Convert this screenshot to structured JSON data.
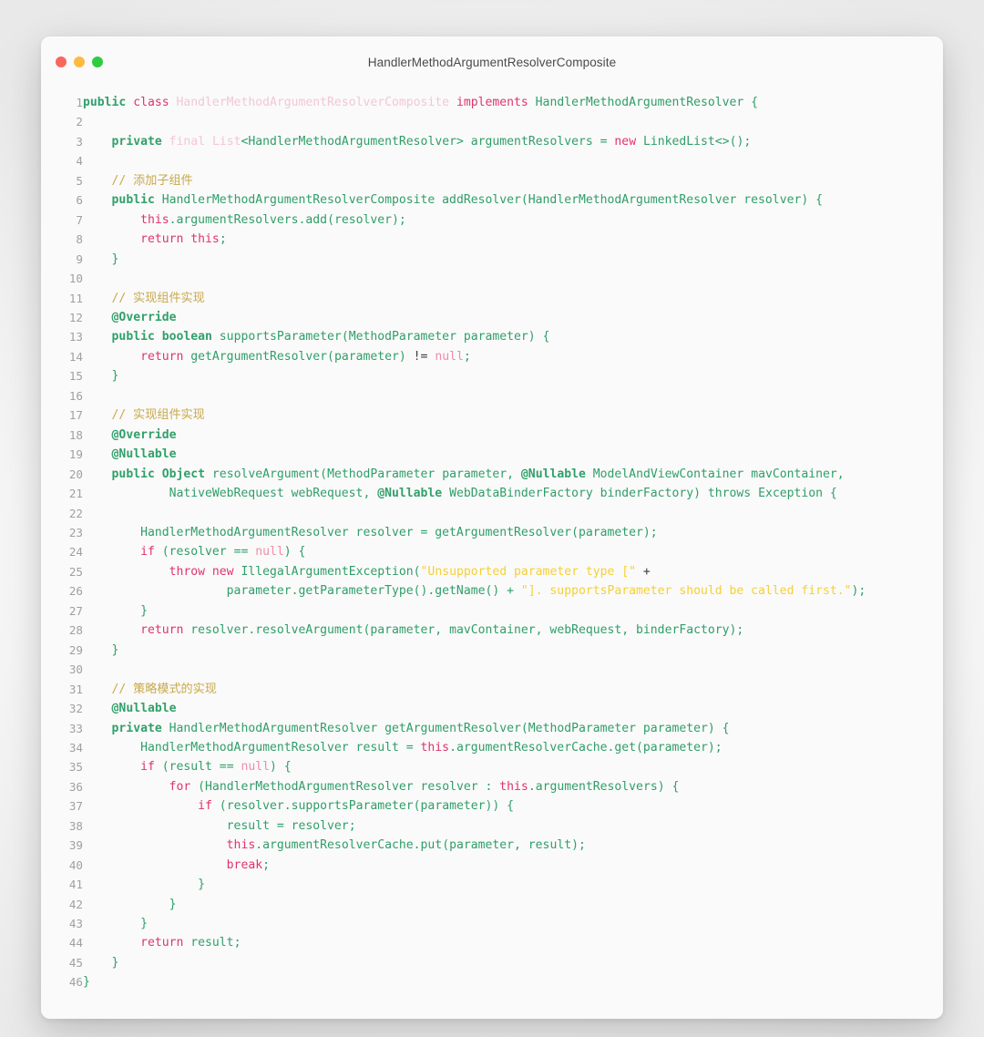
{
  "window": {
    "title": "HandlerMethodArgumentResolverComposite",
    "traffic_lights": [
      {
        "name": "close",
        "color": "#f9665e"
      },
      {
        "name": "minimize",
        "color": "#fcbb40"
      },
      {
        "name": "maximize",
        "color": "#2ecc40"
      }
    ]
  },
  "theme": {
    "background": "#fafafa",
    "page_background": "#ffffff",
    "line_number_color": "#a0a0a0",
    "keyword_color": "#e0346b",
    "declaration_color": "#31a06a",
    "type_color": "#2f9e68",
    "comment_color": "#c8a94b",
    "string_color": "#f5d033",
    "faded_color": "#f3c7d5"
  },
  "editor": {
    "language": "java",
    "first_line": 1,
    "last_line": 46,
    "line_numbers": [
      "1",
      "2",
      "3",
      "4",
      "5",
      "6",
      "7",
      "8",
      "9",
      "10",
      "11",
      "12",
      "13",
      "14",
      "15",
      "16",
      "17",
      "18",
      "19",
      "20",
      "21",
      "22",
      "23",
      "24",
      "25",
      "26",
      "27",
      "28",
      "29",
      "30",
      "31",
      "32",
      "33",
      "34",
      "35",
      "36",
      "37",
      "38",
      "39",
      "40",
      "41",
      "42",
      "43",
      "44",
      "45",
      "46"
    ],
    "lines": [
      "public class HandlerMethodArgumentResolverComposite implements HandlerMethodArgumentResolver {",
      "",
      "    private final List<HandlerMethodArgumentResolver> argumentResolvers = new LinkedList<>();",
      "",
      "    // 添加子组件",
      "    public HandlerMethodArgumentResolverComposite addResolver(HandlerMethodArgumentResolver resolver) {",
      "        this.argumentResolvers.add(resolver);",
      "        return this;",
      "    }",
      "",
      "    // 实现组件实现",
      "    @Override",
      "    public boolean supportsParameter(MethodParameter parameter) {",
      "        return getArgumentResolver(parameter) != null;",
      "    }",
      "",
      "    // 实现组件实现",
      "    @Override",
      "    @Nullable",
      "    public Object resolveArgument(MethodParameter parameter, @Nullable ModelAndViewContainer mavContainer,",
      "            NativeWebRequest webRequest, @Nullable WebDataBinderFactory binderFactory) throws Exception {",
      "",
      "        HandlerMethodArgumentResolver resolver = getArgumentResolver(parameter);",
      "        if (resolver == null) {",
      "            throw new IllegalArgumentException(\"Unsupported parameter type [\" +",
      "                    parameter.getParameterType().getName() + \"]. supportsParameter should be called first.\");",
      "        }",
      "        return resolver.resolveArgument(parameter, mavContainer, webRequest, binderFactory);",
      "    }",
      "",
      "    // 策略模式的实现",
      "    @Nullable",
      "    private HandlerMethodArgumentResolver getArgumentResolver(MethodParameter parameter) {",
      "        HandlerMethodArgumentResolver result = this.argumentResolverCache.get(parameter);",
      "        if (result == null) {",
      "            for (HandlerMethodArgumentResolver resolver : this.argumentResolvers) {",
      "                if (resolver.supportsParameter(parameter)) {",
      "                    result = resolver;",
      "                    this.argumentResolverCache.put(parameter, result);",
      "                    break;",
      "                }",
      "            }",
      "        }",
      "        return result;",
      "    }",
      "}"
    ],
    "tokens": [
      [
        [
          "public ",
          "kw2"
        ],
        [
          "class ",
          "kw"
        ],
        [
          "HandlerMethodArgumentResolverComposite",
          "faded"
        ],
        [
          " implements ",
          "kw"
        ],
        [
          "HandlerMethodArgumentResolver",
          "type"
        ],
        [
          " {",
          "punc"
        ]
      ],
      [],
      [
        [
          "    ",
          "plain"
        ],
        [
          "private ",
          "kw2"
        ],
        [
          "final ",
          "faded"
        ],
        [
          "List",
          "faded"
        ],
        [
          "<HandlerMethodArgumentResolver>",
          "type"
        ],
        [
          " argumentResolvers = ",
          "type"
        ],
        [
          "new ",
          "kw"
        ],
        [
          "LinkedList<>();",
          "type"
        ]
      ],
      [],
      [
        [
          "    // 添加子组件",
          "cmt"
        ]
      ],
      [
        [
          "    ",
          "plain"
        ],
        [
          "public ",
          "kw2"
        ],
        [
          "HandlerMethodArgumentResolverComposite addResolver",
          "type"
        ],
        [
          "(",
          "punc"
        ],
        [
          "HandlerMethodArgumentResolver resolver",
          "type"
        ],
        [
          ") {",
          "punc"
        ]
      ],
      [
        [
          "        ",
          "plain"
        ],
        [
          "this",
          "kw"
        ],
        [
          ".argumentResolvers.add",
          "type"
        ],
        [
          "(",
          "punc"
        ],
        [
          "resolver",
          "type"
        ],
        [
          ");",
          "punc"
        ]
      ],
      [
        [
          "        ",
          "plain"
        ],
        [
          "return ",
          "kw"
        ],
        [
          "this",
          "kw"
        ],
        [
          ";",
          "punc"
        ]
      ],
      [
        [
          "    }",
          "punc"
        ]
      ],
      [],
      [
        [
          "    // 实现组件实现",
          "cmt"
        ]
      ],
      [
        [
          "    ",
          "plain"
        ],
        [
          "@Override",
          "anno"
        ]
      ],
      [
        [
          "    ",
          "plain"
        ],
        [
          "public boolean ",
          "kw2"
        ],
        [
          "supportsParameter",
          "type"
        ],
        [
          "(",
          "punc"
        ],
        [
          "MethodParameter parameter",
          "type"
        ],
        [
          ") {",
          "punc"
        ]
      ],
      [
        [
          "        ",
          "plain"
        ],
        [
          "return ",
          "kw"
        ],
        [
          "getArgumentResolver",
          "type"
        ],
        [
          "(",
          "punc"
        ],
        [
          "parameter",
          "type"
        ],
        [
          ") ",
          "punc"
        ],
        [
          "!= ",
          "plain"
        ],
        [
          "null",
          "nullv"
        ],
        [
          ";",
          "punc"
        ]
      ],
      [
        [
          "    }",
          "punc"
        ]
      ],
      [],
      [
        [
          "    // 实现组件实现",
          "cmt"
        ]
      ],
      [
        [
          "    ",
          "plain"
        ],
        [
          "@Override",
          "anno"
        ]
      ],
      [
        [
          "    ",
          "plain"
        ],
        [
          "@Nullable",
          "anno"
        ]
      ],
      [
        [
          "    ",
          "plain"
        ],
        [
          "public Object ",
          "kw2"
        ],
        [
          "resolveArgument",
          "type"
        ],
        [
          "(",
          "punc"
        ],
        [
          "MethodParameter parameter, ",
          "type"
        ],
        [
          "@Nullable ",
          "anno"
        ],
        [
          "ModelAndViewContainer mavContainer,",
          "type"
        ]
      ],
      [
        [
          "            NativeWebRequest webRequest, ",
          "type"
        ],
        [
          "@Nullable ",
          "anno"
        ],
        [
          "WebDataBinderFactory binderFactory",
          "type"
        ],
        [
          ") ",
          "punc"
        ],
        [
          "throws ",
          "type"
        ],
        [
          "Exception ",
          "type"
        ],
        [
          "{",
          "punc"
        ]
      ],
      [],
      [
        [
          "        HandlerMethodArgumentResolver resolver = getArgumentResolver",
          "type"
        ],
        [
          "(",
          "punc"
        ],
        [
          "parameter",
          "type"
        ],
        [
          ");",
          "punc"
        ]
      ],
      [
        [
          "        ",
          "plain"
        ],
        [
          "if ",
          "kw"
        ],
        [
          "(",
          "punc"
        ],
        [
          "resolver == ",
          "type"
        ],
        [
          "null",
          "nullv"
        ],
        [
          ") {",
          "punc"
        ]
      ],
      [
        [
          "            ",
          "plain"
        ],
        [
          "throw new ",
          "kw"
        ],
        [
          "IllegalArgumentException",
          "type"
        ],
        [
          "(",
          "punc"
        ],
        [
          "\"Unsupported parameter type [\"",
          "str"
        ],
        [
          " +",
          "plain"
        ]
      ],
      [
        [
          "                    parameter.getParameterType",
          "type"
        ],
        [
          "().",
          "punc"
        ],
        [
          "getName",
          "type"
        ],
        [
          "() + ",
          "punc"
        ],
        [
          "\"]. supportsParameter should be called first.\"",
          "str"
        ],
        [
          ");",
          "punc"
        ]
      ],
      [
        [
          "        }",
          "punc"
        ]
      ],
      [
        [
          "        ",
          "plain"
        ],
        [
          "return ",
          "kw"
        ],
        [
          "resolver.resolveArgument",
          "type"
        ],
        [
          "(",
          "punc"
        ],
        [
          "parameter, mavContainer, webRequest, binderFactory",
          "type"
        ],
        [
          ");",
          "punc"
        ]
      ],
      [
        [
          "    }",
          "punc"
        ]
      ],
      [],
      [
        [
          "    // 策略模式的实现",
          "cmt"
        ]
      ],
      [
        [
          "    ",
          "plain"
        ],
        [
          "@Nullable",
          "anno"
        ]
      ],
      [
        [
          "    ",
          "plain"
        ],
        [
          "private ",
          "kw2"
        ],
        [
          "HandlerMethodArgumentResolver getArgumentResolver",
          "type"
        ],
        [
          "(",
          "punc"
        ],
        [
          "MethodParameter parameter",
          "type"
        ],
        [
          ") {",
          "punc"
        ]
      ],
      [
        [
          "        HandlerMethodArgumentResolver result = ",
          "type"
        ],
        [
          "this",
          "kw"
        ],
        [
          ".argumentResolverCache.get",
          "type"
        ],
        [
          "(",
          "punc"
        ],
        [
          "parameter",
          "type"
        ],
        [
          ");",
          "punc"
        ]
      ],
      [
        [
          "        ",
          "plain"
        ],
        [
          "if ",
          "kw"
        ],
        [
          "(",
          "punc"
        ],
        [
          "result == ",
          "type"
        ],
        [
          "null",
          "nullv"
        ],
        [
          ") {",
          "punc"
        ]
      ],
      [
        [
          "            ",
          "plain"
        ],
        [
          "for ",
          "kw"
        ],
        [
          "(",
          "punc"
        ],
        [
          "HandlerMethodArgumentResolver resolver : ",
          "type"
        ],
        [
          "this",
          "kw"
        ],
        [
          ".argumentResolvers",
          "type"
        ],
        [
          ") {",
          "punc"
        ]
      ],
      [
        [
          "                ",
          "plain"
        ],
        [
          "if ",
          "kw"
        ],
        [
          "(",
          "punc"
        ],
        [
          "resolver.supportsParameter",
          "type"
        ],
        [
          "(",
          "punc"
        ],
        [
          "parameter",
          "type"
        ],
        [
          ")) {",
          "punc"
        ]
      ],
      [
        [
          "                    result = resolver",
          "type"
        ],
        [
          ";",
          "punc"
        ]
      ],
      [
        [
          "                    ",
          "plain"
        ],
        [
          "this",
          "kw"
        ],
        [
          ".argumentResolverCache.put",
          "type"
        ],
        [
          "(",
          "punc"
        ],
        [
          "parameter, result",
          "type"
        ],
        [
          ");",
          "punc"
        ]
      ],
      [
        [
          "                    ",
          "plain"
        ],
        [
          "break",
          "kw"
        ],
        [
          ";",
          "punc"
        ]
      ],
      [
        [
          "                }",
          "punc"
        ]
      ],
      [
        [
          "            }",
          "punc"
        ]
      ],
      [
        [
          "        }",
          "punc"
        ]
      ],
      [
        [
          "        ",
          "plain"
        ],
        [
          "return ",
          "kw"
        ],
        [
          "result",
          "type"
        ],
        [
          ";",
          "punc"
        ]
      ],
      [
        [
          "    }",
          "punc"
        ]
      ],
      [
        [
          "}",
          "punc"
        ]
      ]
    ]
  }
}
